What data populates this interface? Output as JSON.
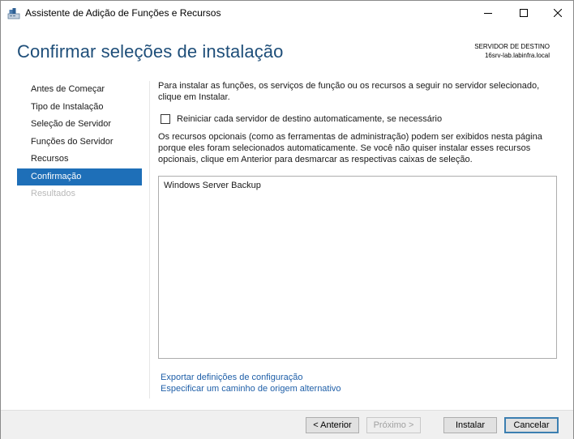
{
  "window": {
    "title": "Assistente de Adição de Funções e Recursos"
  },
  "header": {
    "page_title": "Confirmar seleções de instalação",
    "destination_label": "SERVIDOR DE DESTINO",
    "destination_server": "16srv-lab.labinfra.local"
  },
  "sidebar": {
    "items": [
      {
        "label": "Antes de Começar",
        "state": "normal"
      },
      {
        "label": "Tipo de Instalação",
        "state": "normal"
      },
      {
        "label": "Seleção de Servidor",
        "state": "normal"
      },
      {
        "label": "Funções do Servidor",
        "state": "normal"
      },
      {
        "label": "Recursos",
        "state": "normal"
      },
      {
        "label": "Confirmação",
        "state": "active"
      },
      {
        "label": "Resultados",
        "state": "disabled"
      }
    ]
  },
  "main": {
    "intro": "Para instalar as funções, os serviços de função ou os recursos a seguir no servidor selecionado, clique em Instalar.",
    "restart_checkbox": {
      "label": "Reiniciar cada servidor de destino automaticamente, se necessário",
      "checked": false
    },
    "optional_text": "Os recursos opcionais (como as ferramentas de administração) podem ser exibidos nesta página porque eles foram selecionados automaticamente. Se você não quiser instalar esses recursos opcionais, clique em Anterior para desmarcar as respectivas caixas de seleção.",
    "selections": [
      "Windows Server Backup"
    ],
    "links": {
      "export": "Exportar definições de configuração",
      "source_path": "Especificar um caminho de origem alternativo"
    }
  },
  "footer": {
    "prev_label": "< Anterior",
    "next_label": "Próximo >",
    "install_label": "Instalar",
    "cancel_label": "Cancelar"
  },
  "colors": {
    "accent": "#1e6fb8",
    "title": "#1e4e79",
    "link": "#1f5fa8"
  }
}
